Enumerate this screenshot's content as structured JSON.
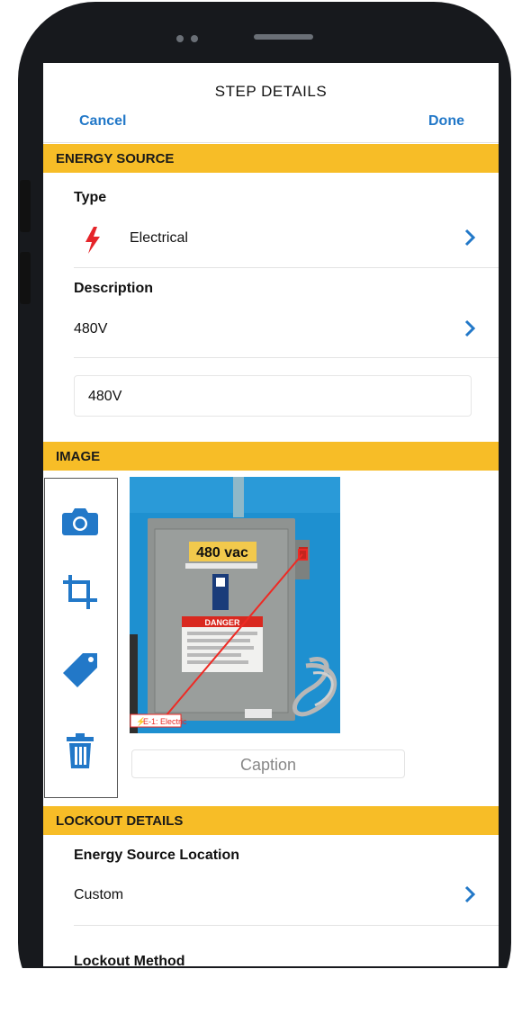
{
  "nav": {
    "title": "STEP DETAILS",
    "cancel_label": "Cancel",
    "done_label": "Done"
  },
  "energy_source": {
    "section_title": "ENERGY SOURCE",
    "type_label": "Type",
    "type_value": "Electrical",
    "type_icon": "lightning-bolt-icon",
    "description_label": "Description",
    "description_value": "480V",
    "description_input_value": "480V"
  },
  "image": {
    "section_title": "IMAGE",
    "tools": [
      "camera-icon",
      "crop-icon",
      "tag-icon",
      "trash-icon"
    ],
    "photo": {
      "sign_label": "480 vac",
      "tag_label": "E-1: Electric",
      "warning_label": "DANGER"
    },
    "caption_placeholder": "Caption"
  },
  "lockout": {
    "section_title": "LOCKOUT DETAILS",
    "location_label": "Energy Source Location",
    "location_value": "Custom",
    "method_label": "Lockout Method"
  },
  "colors": {
    "accent": "#2278c8",
    "section_bg": "#f7bd27",
    "bolt": "#e5252a",
    "phone_frame": "#17191d"
  }
}
